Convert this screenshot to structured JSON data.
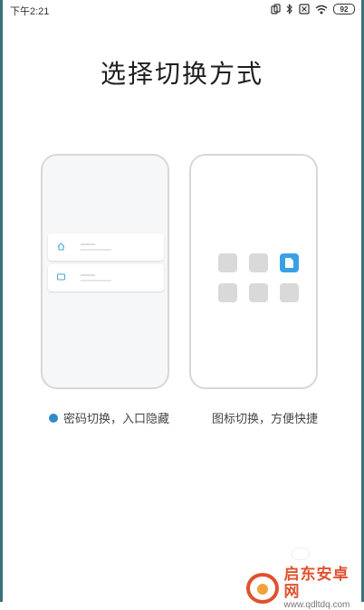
{
  "status_bar": {
    "time": "下午2:21",
    "battery": "92",
    "icons": [
      "screen-rotate-icon",
      "bluetooth-icon",
      "sim-off-icon",
      "wifi-icon",
      "battery-icon"
    ]
  },
  "title": "选择切换方式",
  "options": [
    {
      "caption": "密码切换，入口隐藏",
      "selected": true,
      "preview": "list-preview"
    },
    {
      "caption": "图标切换，方便快捷",
      "selected": false,
      "preview": "icon-grid-preview"
    }
  ],
  "watermark": {
    "title": "启东安卓网",
    "url": "www.qdltdq.com"
  },
  "colors": {
    "selected_dot": "#2f8bc9",
    "active_tile": "#3aa0e6",
    "watermark_orange": "#e0512e"
  }
}
